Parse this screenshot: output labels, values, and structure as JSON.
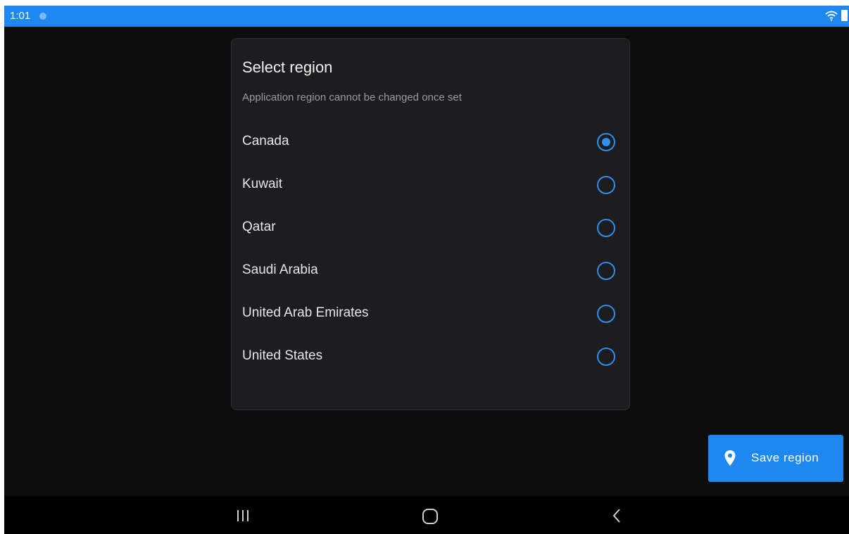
{
  "status_bar": {
    "time": "1:01",
    "background_color": "#1e88f0",
    "icons": [
      "notification-dot-icon",
      "wifi-icon",
      "battery-icon"
    ]
  },
  "dialog": {
    "title": "Select region",
    "subtitle": "Application region cannot be changed once set",
    "regions": [
      {
        "label": "Canada",
        "selected": true
      },
      {
        "label": "Kuwait",
        "selected": false
      },
      {
        "label": "Qatar",
        "selected": false
      },
      {
        "label": "Saudi Arabia",
        "selected": false
      },
      {
        "label": "United Arab Emirates",
        "selected": false
      },
      {
        "label": "United States",
        "selected": false
      }
    ],
    "accent_color": "#2f8ef0"
  },
  "save_button": {
    "label": "Save region",
    "icon": "location-pin-icon",
    "color": "#1e88f0"
  },
  "nav_bar": {
    "icons": [
      "recent-apps-icon",
      "home-icon",
      "back-icon"
    ]
  }
}
